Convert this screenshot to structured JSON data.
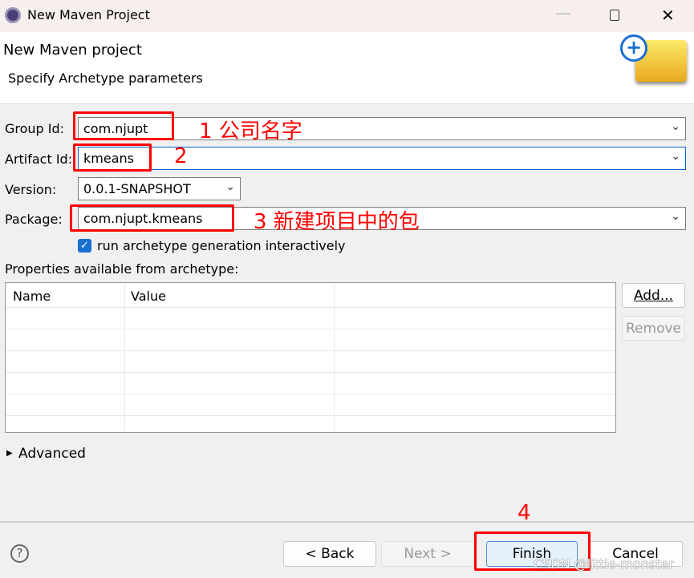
{
  "window": {
    "title": "New Maven Project"
  },
  "header": {
    "title": "New Maven project",
    "subtitle": "Specify Archetype parameters"
  },
  "form": {
    "group_id": {
      "label": "Group Id:",
      "value": "com.njupt"
    },
    "artifact_id": {
      "label": "Artifact Id:",
      "value": "kmeans"
    },
    "version": {
      "label": "Version:",
      "value": "0.0.1-SNAPSHOT"
    },
    "package": {
      "label": "Package:",
      "value": "com.njupt.kmeans"
    },
    "interactive": {
      "label": "run archetype generation interactively",
      "checked": true
    },
    "properties_label": "Properties available from archetype:",
    "table": {
      "columns": [
        "Name",
        "Value"
      ],
      "rows": []
    },
    "add_label": "Add...",
    "remove_label": "Remove",
    "advanced_label": "Advanced"
  },
  "annotations": {
    "a1": "1 公司名字",
    "a2": "2",
    "a3": "3 新建项目中的包",
    "a4": "4"
  },
  "footer": {
    "back": "< Back",
    "next": "Next >",
    "finish": "Finish",
    "cancel": "Cancel"
  },
  "watermark": "CSDN @little-monster"
}
